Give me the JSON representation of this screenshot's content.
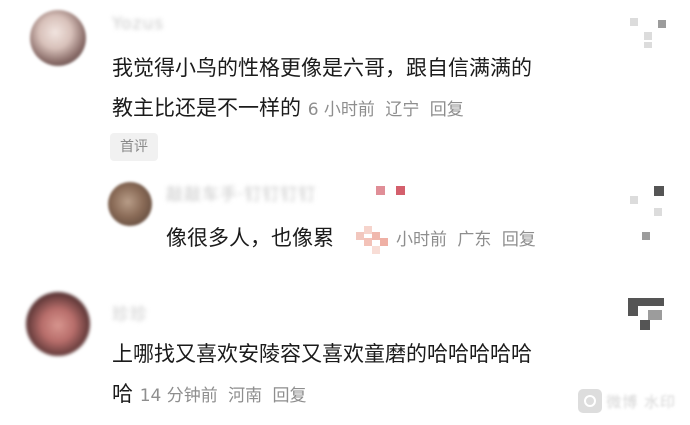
{
  "comments": [
    {
      "username": "Yozus",
      "text_line1": "我觉得小鸟的性格更像是六哥，跟自信满满的",
      "text_line2": "教主比还是不一样的",
      "time": "6 小时前",
      "location": "辽宁",
      "reply": "回复",
      "badge": "首评"
    }
  ],
  "reply_comment": {
    "username": "敲敲车手·钉钉钉钉",
    "text": "像很多人，也像累",
    "time": "小时前",
    "location": "广东",
    "reply": "回复"
  },
  "comment3": {
    "username": "珍珍",
    "text_line1": "上哪找又喜欢安陵容又喜欢童磨的哈哈哈哈哈",
    "text_line2": "哈",
    "time": "14 分钟前",
    "location": "河南",
    "reply": "回复"
  },
  "watermark": {
    "text": "微博 水印"
  },
  "colors": {
    "text": "#1b1b1b",
    "meta": "#8e8e8e",
    "badge_bg": "#f1f1f1"
  }
}
